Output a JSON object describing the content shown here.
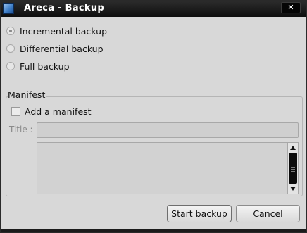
{
  "window": {
    "title": "Areca - Backup",
    "close_glyph": "✕"
  },
  "backup_type": {
    "options": [
      {
        "label": "Incremental backup",
        "selected": true
      },
      {
        "label": "Differential backup",
        "selected": false
      },
      {
        "label": "Full backup",
        "selected": false
      }
    ]
  },
  "manifest": {
    "group_title": "Manifest",
    "add_label": "Add a manifest",
    "add_checked": false,
    "title_label": "Title :",
    "title_value": "",
    "description_value": ""
  },
  "buttons": {
    "start_label": "Start backup",
    "cancel_label": "Cancel"
  },
  "colors": {
    "titlebar": "#0e0e0e",
    "window_bg": "#d8d8d8",
    "app_icon": "#3f7fc8"
  },
  "icons": {
    "app": "areca-app-icon",
    "close": "close-icon"
  }
}
